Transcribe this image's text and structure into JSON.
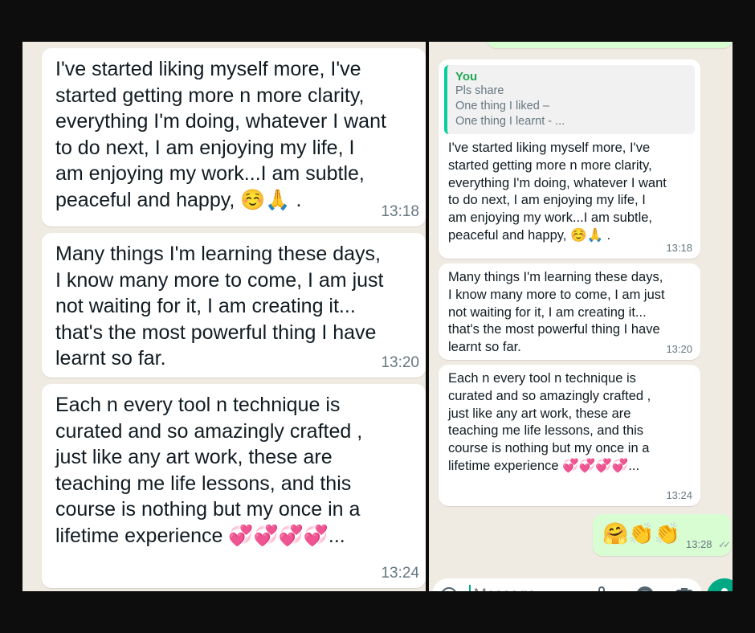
{
  "left_panel": {
    "messages": [
      {
        "text": "I've started liking myself more, I've\nstarted getting more n more clarity,\neverything I'm doing, whatever I want\nto do next, I am enjoying my life, I\nam enjoying my work...I am subtle,\npeaceful and happy,",
        "emoji_tail": " ☺️🙏 .",
        "time": "13:18"
      },
      {
        "text": "Many things I'm learning these days,\nI know many more to come, I am just\nnot waiting for it, I am creating it...\nthat's the most powerful thing I have\nlearnt so far.",
        "time": "13:20"
      },
      {
        "text": "Each n every tool n technique is\ncurated and so amazingly crafted ,\njust like any art work, these are\nteaching me life lessons, and this\ncourse is nothing but my once in a\nlifetime experience",
        "emoji_tail": " 💞💞💞💞...",
        "time": "13:24"
      }
    ]
  },
  "right_panel": {
    "quote": {
      "author": "You",
      "lines": [
        "Pls share",
        "One thing I liked –",
        "One thing I learnt - ..."
      ]
    },
    "messages": [
      {
        "text": "I've started liking myself more, I've\nstarted getting more n more clarity,\neverything I'm doing, whatever I want\nto do next, I am enjoying my life, I\nam enjoying my work...I am subtle,\npeaceful and happy,",
        "emoji_tail": " ☺️🙏 .",
        "time": "13:18"
      },
      {
        "text": "Many things I'm learning these days,\nI know many more to come, I am just\nnot waiting for it, I am creating it...\nthat's the most powerful thing I have\nlearnt so far.",
        "time": "13:20"
      },
      {
        "text": "Each n every tool n technique is\ncurated and so amazingly crafted ,\njust like any art work, these are\nteaching me life lessons, and this\ncourse is nothing but my once in a\nlifetime experience",
        "emoji_tail": " 💞💞💞💞...",
        "time": "13:24"
      }
    ],
    "sent_message": {
      "emojis": "🤗👏👏",
      "time": "13:28",
      "status_icon": "double-check-icon"
    },
    "composer": {
      "placeholder": "Message",
      "icons": [
        "emoji-icon",
        "attach-icon",
        "rupee-payment-icon",
        "camera-icon",
        "mic-icon"
      ]
    }
  },
  "colors": {
    "background": "#0d0d0d",
    "chat_wallpaper": "#efeae2",
    "incoming_bubble": "#ffffff",
    "outgoing_bubble": "#d9fdd3",
    "quote_accent": "#06cf9c",
    "quote_author": "#1fa855",
    "timestamp": "#667781",
    "mic_button": "#00a884"
  }
}
